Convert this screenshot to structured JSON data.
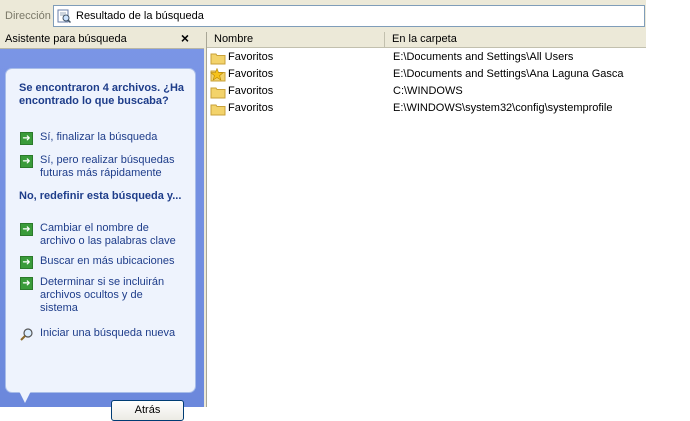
{
  "address": {
    "label": "Dirección",
    "value": "Resultado de la búsqueda",
    "icon": "search-results-icon"
  },
  "assistant": {
    "title": "Asistente para búsqueda",
    "close_label": "×",
    "result_heading": "Se encontraron 4 archivos. ¿Ha encontrado lo que buscaba?",
    "options_yes": [
      {
        "label": "Sí, finalizar la búsqueda"
      },
      {
        "label": "Sí, pero realizar búsquedas futuras más rápidamente"
      }
    ],
    "refine_heading": "No, redefinir esta búsqueda y...",
    "options_refine": [
      {
        "label": "Cambiar el nombre de archivo o las palabras clave"
      },
      {
        "label": "Buscar en más ubicaciones"
      },
      {
        "label": "Determinar si se incluirán archivos ocultos y de sistema"
      }
    ],
    "new_search_label": "Iniciar una búsqueda nueva",
    "back_button": "Atrás"
  },
  "results": {
    "columns": [
      "Nombre",
      "En la carpeta"
    ],
    "rows": [
      {
        "name": "Favoritos",
        "folder": "E:\\Documents and Settings\\All Users",
        "icon": "folder-icon"
      },
      {
        "name": "Favoritos",
        "folder": "E:\\Documents and Settings\\Ana Laguna Gasca",
        "icon": "favorites-star-folder-icon"
      },
      {
        "name": "Favoritos",
        "folder": "C:\\WINDOWS",
        "icon": "folder-icon"
      },
      {
        "name": "Favoritos",
        "folder": "E:\\WINDOWS\\system32\\config\\systemprofile",
        "icon": "folder-icon"
      }
    ]
  },
  "colors": {
    "pane_blue": "#6f8ee0",
    "link_blue": "#1e3d8a",
    "arrow_green": "#3a9b3a",
    "folder_yellow": "#f3d36b"
  }
}
